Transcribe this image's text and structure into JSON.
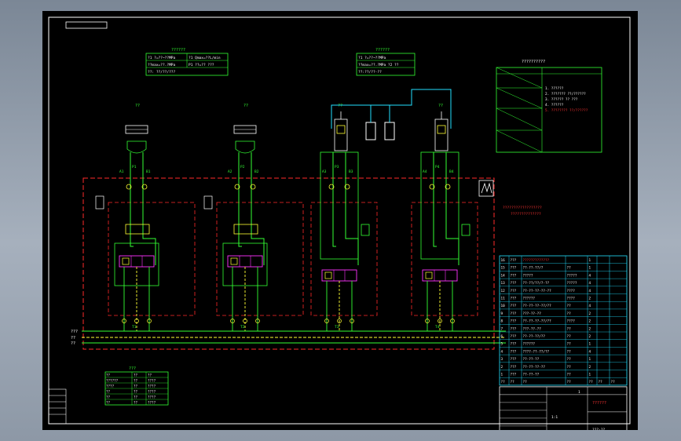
{
  "colors": {
    "bg": "#000000",
    "frame": "#ffffff",
    "line": "#33ff33",
    "dash": "#ff2a2a",
    "yellow": "#ffff33",
    "cyan": "#22e0ff",
    "magenta": "#ff33ff",
    "red": "#ff3333",
    "white": "#ffffff"
  },
  "drawing": {
    "units": [
      {
        "title": "??",
        "p1": "11",
        "p2": "21",
        "p3": "A1",
        "p4": "B1",
        "port_top": "P1",
        "port_bot": "T1"
      },
      {
        "title": "??",
        "p1": "12",
        "p2": "22",
        "p3": "A2",
        "p4": "B2",
        "port_top": "P2",
        "port_bot": "T2"
      },
      {
        "title": "??",
        "p1": "13",
        "p2": "23",
        "p3": "A3",
        "p4": "B3",
        "port_top": "P3",
        "port_bot": "T3"
      },
      {
        "title": "??",
        "p1": "14",
        "p2": "24",
        "p3": "A4",
        "p4": "B4",
        "port_top": "P4",
        "port_bot": "T4"
      }
    ],
    "param_table_left": {
      "title": "??????",
      "rows": [
        [
          "?1 ?=??~??MPa",
          "?1 Qmax=??L/min"
        ],
        [
          "??max=??.?MPa",
          "P1 ??=?? ???"
        ],
        [
          "??: ??/??/???"
        ]
      ]
    },
    "param_table_mid": {
      "title": "??????",
      "rows": [
        [
          "?1 ?=??~??MPa"
        ],
        [
          "??max=??.?MPa ?2 ??"
        ],
        [
          "??:??/??-??"
        ]
      ]
    },
    "notes_title": "??????????",
    "notes": [
      "1. ??????",
      "2. ??????? ??/??????",
      "3. ?????? ?? ???",
      "4. ??????",
      "5. ???????? ??/??????"
    ],
    "red_note": [
      "??????????????????",
      "??????????????"
    ],
    "bus_labels": [
      "???",
      "??",
      "??"
    ],
    "bom_header": [
      "??",
      "??",
      "??",
      "??",
      "??",
      "??",
      "??"
    ],
    "bom_rows": [
      [
        "16",
        "???",
        "?????????????",
        "",
        "1",
        "",
        ""
      ],
      [
        "15",
        "???",
        "??-??-??/?",
        "??",
        "1",
        "",
        ""
      ],
      [
        "14",
        "???",
        "?????",
        "?????",
        "4",
        "",
        ""
      ],
      [
        "13",
        "???",
        "??-??/??/?-??",
        "?????",
        "4",
        "",
        ""
      ],
      [
        "12",
        "???",
        "??-??-??-??-??",
        "????",
        "4",
        "",
        ""
      ],
      [
        "11",
        "???",
        "??????",
        "????",
        "2",
        "",
        ""
      ],
      [
        "10",
        "???",
        "??-??-??-??/??",
        "??",
        "4",
        "",
        ""
      ],
      [
        "9",
        "???",
        "???-??-??",
        "??",
        "2",
        "",
        ""
      ],
      [
        "8",
        "???",
        "??-??-??-??/??",
        "????",
        "2",
        "",
        ""
      ],
      [
        "7",
        "???",
        "???-??-??",
        "??",
        "2",
        "",
        ""
      ],
      [
        "6",
        "???",
        "??-??-??/??",
        "??",
        "2",
        "",
        ""
      ],
      [
        "5",
        "???",
        "??????",
        "??",
        "1",
        "",
        ""
      ],
      [
        "4",
        "???",
        "????-??-??/??",
        "??",
        "4",
        "",
        ""
      ],
      [
        "3",
        "???",
        "??-??-??",
        "??",
        "1",
        "",
        ""
      ],
      [
        "2",
        "???",
        "??-??-??-??",
        "??",
        "2",
        "",
        ""
      ],
      [
        "1",
        "???",
        "??-??-??",
        "??",
        "1",
        "",
        ""
      ]
    ],
    "title_block": {
      "name": "??????",
      "code": "???-??",
      "scale": "1:1",
      "sheet": "1"
    },
    "small_table": {
      "title": "???",
      "rows": [
        [
          "??",
          "??",
          "??"
        ],
        [
          "??????",
          "??",
          "????"
        ],
        [
          "????",
          "??",
          "????"
        ],
        [
          "??",
          "??",
          "????"
        ],
        [
          "??",
          "??",
          "????"
        ],
        [
          "??",
          "??",
          "????"
        ]
      ]
    }
  }
}
